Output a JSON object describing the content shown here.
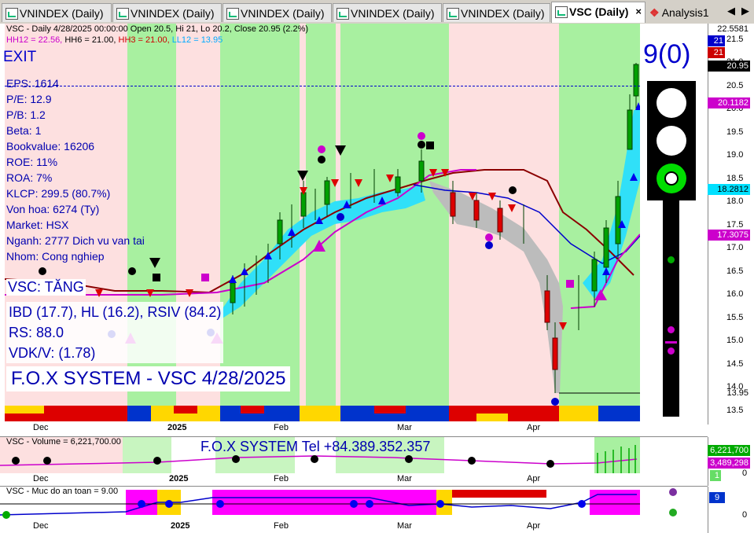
{
  "tabs": [
    {
      "label": "VNINDEX (Daily)",
      "active": false
    },
    {
      "label": "VNINDEX (Daily)",
      "active": false
    },
    {
      "label": "VNINDEX (Daily)",
      "active": false
    },
    {
      "label": "VNINDEX (Daily)",
      "active": false
    },
    {
      "label": "VNINDEX (Daily)",
      "active": false
    },
    {
      "label": "VSC (Daily)",
      "active": true,
      "close": "×"
    },
    {
      "label": "Analysis1",
      "active": false
    }
  ],
  "tab_arrows": {
    "left": "◀",
    "right": "▶"
  },
  "main": {
    "header_line1": "VSC - Daily 4/28/2025 00:00:00 Open 20.5, Hi 21, Lo 20.2, Close 20.95 (2.2%)",
    "header_hh12": "HH12 = 22.56,",
    "header_hh6": "HH6 = 21.00,",
    "header_hh3": "HH3 = 21.00,",
    "header_ll12": "LL12 = 13.95",
    "exit_label": "EXIT",
    "fundamentals": [
      "EPS: 1614",
      "P/E: 12.9",
      "P/B: 1.2",
      "Beta: 1",
      "Bookvalue: 16206",
      "ROE: 11%",
      "ROA: 7%",
      "KLCP: 299.5 (80.7%)",
      "Von hoa: 6274 (Ty)",
      "Market: HSX",
      "Nganh: 2777 Dich vu van tai",
      "Nhom: Cong nghiep"
    ],
    "trend_label": "VSC: TĂNG",
    "indicators": [
      "IBD (17.7), HL (16.2), RSIV (84.2)",
      "RS: 88.0",
      "VDK/V:  (1.78)"
    ],
    "fox_title": "F.O.X SYSTEM - VSC 4/28/2025",
    "signal_count": "9(0)",
    "price_ticks": [
      "21.5",
      "21.0",
      "20.5",
      "20.0",
      "19.5",
      "19.0",
      "18.5",
      "18.0",
      "17.5",
      "17.0",
      "16.5",
      "16.0",
      "15.5",
      "15.0",
      "14.5",
      "14.0",
      "13.5"
    ],
    "price_tags": [
      {
        "text": "22.5581",
        "bg": "#ffffff",
        "fg": "#000000"
      },
      {
        "text": "21",
        "bg": "#0000cc",
        "fg": "#ffffff"
      },
      {
        "text": "21",
        "bg": "#cc0000",
        "fg": "#ffffff"
      },
      {
        "text": "20.95",
        "bg": "#000000",
        "fg": "#ffffff"
      },
      {
        "text": "20.1182",
        "bg": "#cc00cc",
        "fg": "#ffffff"
      },
      {
        "text": "18.2812",
        "bg": "#00e0ff",
        "fg": "#000000"
      },
      {
        "text": "17.3075",
        "bg": "#cc00cc",
        "fg": "#ffffff"
      },
      {
        "text": "13.95",
        "bg": "#ffffff",
        "fg": "#000000"
      }
    ],
    "months": [
      "Dec",
      "2025",
      "Feb",
      "Mar",
      "Apr"
    ]
  },
  "volume": {
    "header": "VSC - Volume = 6,221,700.00",
    "fox_tel": "F.O.X SYSTEM Tel +84.389.352.357",
    "tags": [
      {
        "text": "6,221,700",
        "bg": "#00aa00",
        "fg": "#ffffff"
      },
      {
        "text": "3,489,298",
        "bg": "#cc00cc",
        "fg": "#ffffff"
      },
      {
        "text": "1",
        "bg": "#66dd66",
        "fg": "#ffffff"
      }
    ],
    "scale_zero": "0"
  },
  "safety": {
    "header": "VSC - Muc do an toan = 9.00",
    "tag": "9",
    "scale_zero": "0"
  },
  "colors": {
    "bg_green": "#a8f0a0",
    "bg_pink": "#fde0e0",
    "cloud": "#30e0f8",
    "blue": "#0000cc",
    "magenta": "#cc00cc",
    "red": "#dd0000"
  }
}
